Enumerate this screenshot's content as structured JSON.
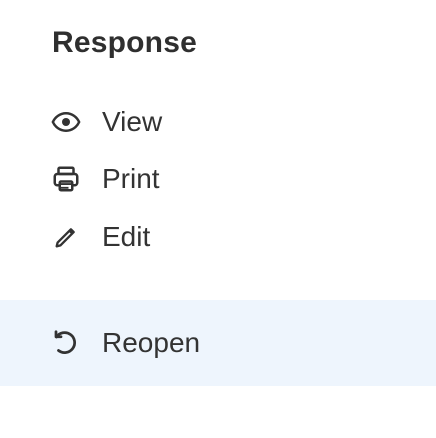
{
  "panel": {
    "title": "Response"
  },
  "menu": {
    "items": [
      {
        "label": "View",
        "icon": "eye-icon"
      },
      {
        "label": "Print",
        "icon": "printer-icon"
      },
      {
        "label": "Edit",
        "icon": "pencil-icon"
      },
      {
        "label": "Reopen",
        "icon": "undo-icon"
      }
    ]
  },
  "colors": {
    "text": "#333333",
    "highlight": "#eef5fd",
    "indicator": "#6f6f6f"
  }
}
